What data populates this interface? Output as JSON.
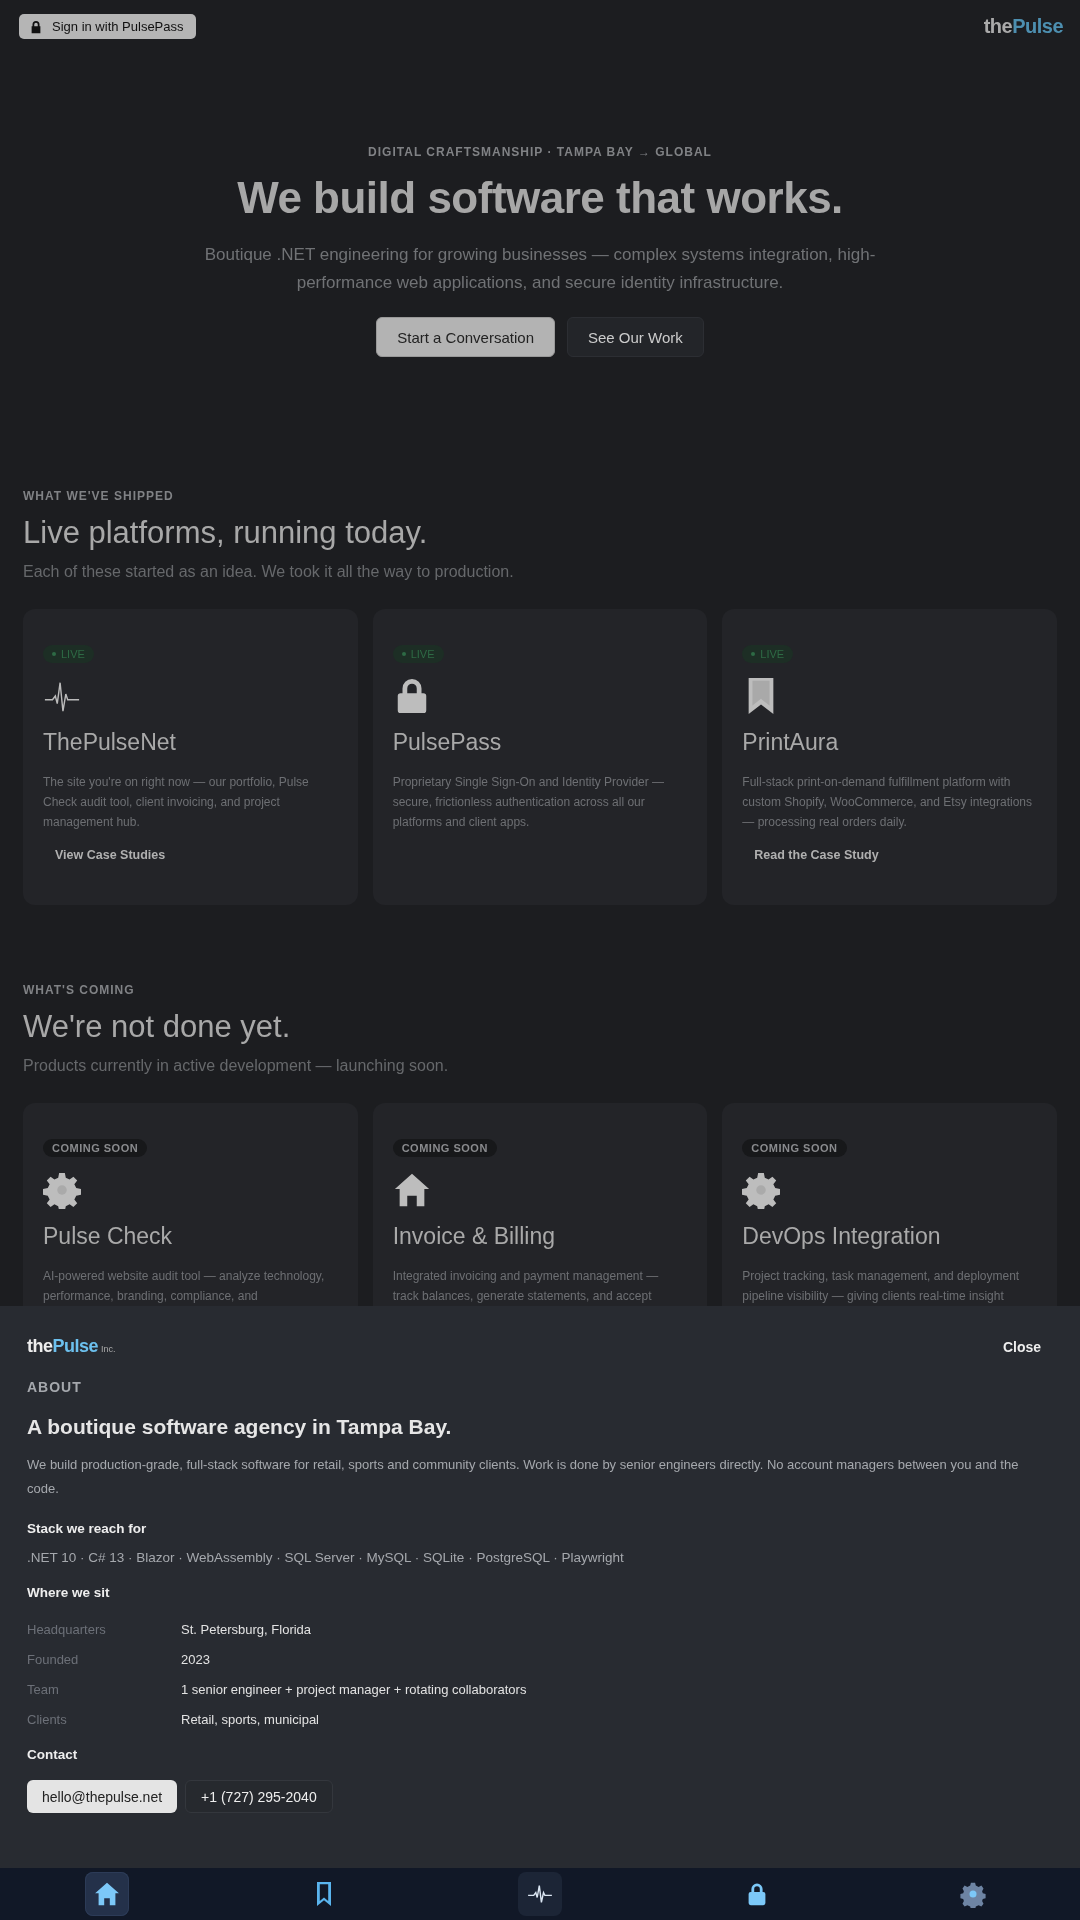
{
  "header": {
    "signin_label": "Sign in with PulsePass",
    "logo": {
      "prefix": "the",
      "accent": "Pulse"
    }
  },
  "hero": {
    "eyebrow": "DIGITAL CRAFTSMANSHIP · TAMPA BAY → GLOBAL",
    "title": "We build software that works.",
    "subtitle": "Boutique .NET engineering for growing businesses — complex systems integration, high-performance web applications, and secure identity infrastructure.",
    "buttons": [
      {
        "label": "Start a Conversation",
        "kind": "primary"
      },
      {
        "label": "See Our Work",
        "kind": "secondary"
      }
    ]
  },
  "sections": [
    {
      "eyebrow": "WHAT WE'VE SHIPPED",
      "title": "Live platforms, running today.",
      "subtitle": "Each of these started as an idea. We took it all the way to production.",
      "cards": [
        {
          "badge": "LIVE",
          "kind": "live",
          "title": "ThePulseNet",
          "description": "The site you're on right now — our portfolio, Pulse Check audit tool, client invoicing, and project management hub.",
          "link": "View Case Studies"
        },
        {
          "badge": "LIVE",
          "kind": "live",
          "title": "PulsePass",
          "description": "Proprietary Single Sign-On and Identity Provider — secure, frictionless authentication across all our platforms and client apps."
        },
        {
          "badge": "LIVE",
          "kind": "live",
          "title": "PrintAura",
          "description": "Full-stack print-on-demand fulfillment platform with custom Shopify, WooCommerce, and Etsy integrations — processing real orders daily.",
          "link": "Read the Case Study"
        }
      ]
    },
    {
      "eyebrow": "WHAT'S COMING",
      "title": "We're not done yet.",
      "subtitle": "Products currently in active development — launching soon.",
      "cards": [
        {
          "badge": "COMING SOON",
          "kind": "soon",
          "title": "Pulse Check",
          "description": "AI-powered website audit tool — analyze technology, performance, branding, compliance, and"
        },
        {
          "badge": "COMING SOON",
          "kind": "soon",
          "title": "Invoice & Billing",
          "description": "Integrated invoicing and payment management — track balances, generate statements, and accept"
        },
        {
          "badge": "COMING SOON",
          "kind": "soon",
          "title": "DevOps Integration",
          "description": "Project tracking, task management, and deployment pipeline visibility — giving clients real-time insight"
        }
      ]
    }
  ],
  "about_sheet": {
    "logo": {
      "prefix": "the",
      "accent": "Pulse",
      "suffix": "Inc."
    },
    "close_label": "Close",
    "eyebrow": "ABOUT",
    "title": "A boutique software agency in Tampa Bay.",
    "paragraph": "We build production-grade, full-stack software for retail, sports and community clients. Work is done by senior engineers directly. No account managers between you and the code.",
    "stack_heading": "Stack we reach for",
    "stack": ".NET 10 · C# 13 · Blazor · WebAssembly · SQL Server · MySQL · SQLite · PostgreSQL · Playwright",
    "where_heading": "Where we sit",
    "facts": [
      {
        "label": "Headquarters",
        "value": "St. Petersburg, Florida"
      },
      {
        "label": "Founded",
        "value": "2023"
      },
      {
        "label": "Team",
        "value": "1 senior engineer + project manager + rotating collaborators"
      },
      {
        "label": "Clients",
        "value": "Retail, sports, municipal"
      }
    ],
    "contact_heading": "Contact",
    "contacts": [
      {
        "label": "hello@thepulse.net",
        "kind": "primary"
      },
      {
        "label": "+1 (727) 295-2040",
        "kind": "secondary"
      }
    ]
  },
  "bottom_nav": [
    {
      "selected": true,
      "kind": "tab"
    },
    {
      "selected": false,
      "kind": "tab"
    },
    {
      "selected": false,
      "kind": "center"
    },
    {
      "selected": false,
      "kind": "tab"
    },
    {
      "selected": false,
      "kind": "tab"
    }
  ]
}
